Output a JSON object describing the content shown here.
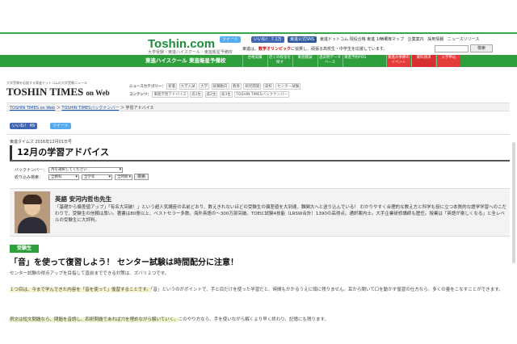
{
  "portal": {
    "logo": "Toshin.com",
    "logo_sub": "大学受験・東進ハイスクール・東進衛星予備校",
    "tweet_label": "ツイート",
    "like_label": "いいね！ 7.1万",
    "sns_label": "東進公式SNS",
    "links": [
      "サイトマップ",
      "企業案内",
      "採用情報",
      "ニュースリリース"
    ],
    "top_text": "東進ドットコム 現役合格 東進 100周年"
  },
  "promo": {
    "text_pre": "東進は、",
    "text_link": "数学オリンピック",
    "text_post": "に協賛し、頑張る高校生・中学生を応援しています。"
  },
  "search": {
    "button": "検索",
    "google": "Google"
  },
  "nav": {
    "brand": "東進ハイスクール 東進衛星予備校",
    "items": [
      "合格実績",
      "近くの校舎を探す",
      "東進模試",
      "過去問データベース",
      "東進予約POS"
    ],
    "red_items": [
      "東進の季節のイベント",
      "資料請求",
      "入学申込"
    ]
  },
  "times": {
    "tagline": "大学受験を応援する東進ドットコムの大学受験ニュース",
    "logo": "TOSHIN TIMES",
    "logo_small": "on Web",
    "subnav_row1": [
      "ニュースカテゴリー：",
      "新着",
      "大学入試",
      "大学",
      "就職動向",
      "教育",
      "研究開発",
      "高校",
      "センター試験"
    ],
    "subnav_row2": [
      "コンテンツ：",
      "東進学習アドバイス",
      "高1生",
      "高2生",
      "高3生",
      "TOSHIN TIMESバックナンバー"
    ]
  },
  "breadcrumb": {
    "items": [
      "TOSHIN TIMES on Web",
      "TOSHIN TIMESバックナンバー",
      "学習アドバイス"
    ],
    "sep": "＞"
  },
  "share": {
    "like": "いいね！ 49",
    "tweet": "ツイート"
  },
  "article": {
    "date": "東進タイムズ 2016年12月01日号",
    "title": "12月の学習アドバイス",
    "filter": {
      "backnumber_label": "バックナンバー：",
      "backnumber_value": "月を選択してください",
      "narrow_label": "絞り込み検索：",
      "subject_value": "全教科",
      "grade_value": "全学年",
      "period_value": "全時期",
      "button": "検索"
    },
    "teacher": {
      "name": "英語 安河内哲也先生",
      "desc": "「基礎から偏差値アップ」「有名大突破！」という超人気講座の名前どおり、数えきれないほどの受験生の偏差値を大到達、難関大へと送り込んでいる！ わかりやすく合理的な教え方と科学も役に立つ本質的な語学学習へのこだわりで、受験生の信頼は厚い。著書は80冊以上、ベストセラー多数。海外英語の〜300万部突破。TOEIC試験4技能（LRSW合計）1390の高得点。通訳案内士。大手企業研修講師も歴任。授業は「英語が楽しくなる」と全レベルの受験生に大評判。"
    },
    "badge": "受験生",
    "heading": "「音」を使って復習しよう！ センター試験は時間配分に注意！",
    "para1": "センター試験の得点アップを目指して直前までできる対策は、ズバリ２つです。",
    "para2_hl": "１つ目は、今まで学んできた内容を「音を使って」復習することです。",
    "para2_rest": "「音」というのがポイントで、手と目だけを使った学習だと、時間もかかるうえに頭に残りません。耳から聞いて口を動かす復習の仕方なら、多くの量をこなすことができます。",
    "para3_hl": "例文は短文問題なら、問題を音読し、四択問題であれば穴を埋めながら解いていく。",
    "para3_rest": "このやり方なら、手を使いながら解くより早く終わり、記憶にも残ります。"
  }
}
